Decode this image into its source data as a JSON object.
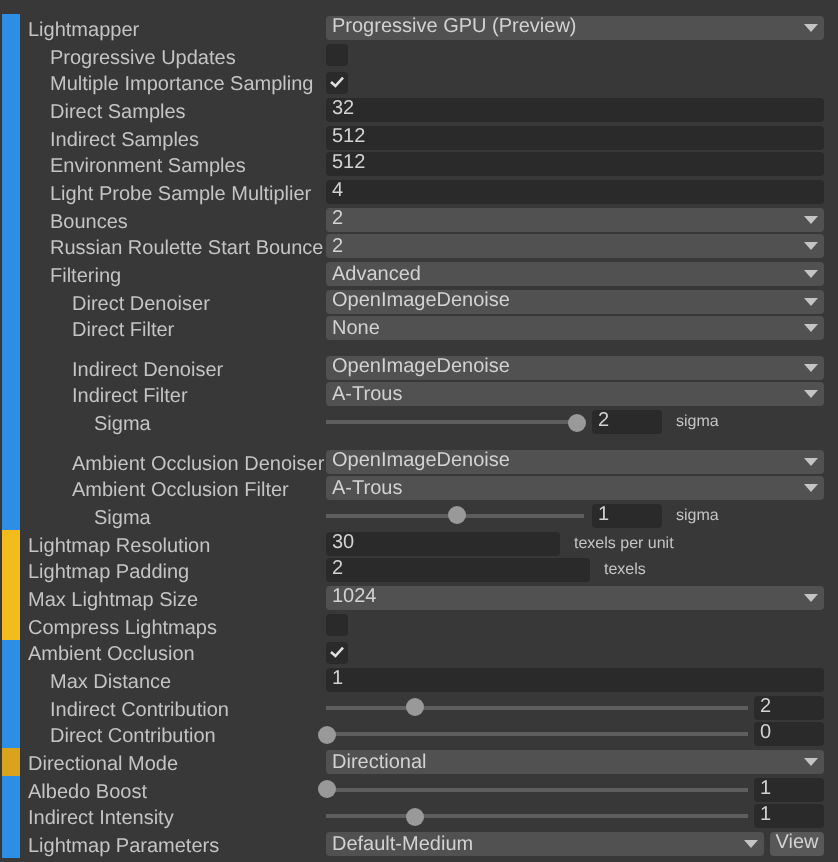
{
  "settings": [
    {
      "label": "Lightmapper",
      "kind": "dropdown",
      "value": "Progressive GPU (Preview)",
      "color": "#2d8ee6",
      "children": [
        {
          "label": "Progressive Updates",
          "kind": "checkbox",
          "checked": false
        },
        {
          "label": "Multiple Importance Sampling",
          "kind": "checkbox",
          "checked": true
        },
        {
          "label": "Direct Samples",
          "kind": "field",
          "value": "32"
        },
        {
          "label": "Indirect Samples",
          "kind": "field",
          "value": "512"
        },
        {
          "label": "Environment Samples",
          "kind": "field",
          "value": "512"
        },
        {
          "label": "Light Probe Sample Multiplier",
          "kind": "field",
          "value": "4"
        },
        {
          "label": "Bounces",
          "kind": "dropdown",
          "value": "2"
        },
        {
          "label": "Russian Roulette Start Bounce",
          "kind": "dropdown",
          "value": "2"
        },
        {
          "label": "Filtering",
          "kind": "dropdown",
          "value": "Advanced",
          "children": [
            {
              "label": "Direct Denoiser",
              "kind": "dropdown",
              "value": "OpenImageDenoise"
            },
            {
              "label": "Direct Filter",
              "kind": "dropdown",
              "value": "None"
            },
            {
              "label": "Indirect Denoiser",
              "kind": "dropdown",
              "value": "OpenImageDenoise",
              "gap_before": true
            },
            {
              "label": "Indirect Filter",
              "kind": "dropdown",
              "value": "A-Trous",
              "children": [
                {
                  "label": "Sigma",
                  "kind": "slider_unit",
                  "value": "2",
                  "unit": "sigma",
                  "level": 0.97
                }
              ]
            },
            {
              "label": "Ambient Occlusion Denoiser",
              "kind": "dropdown",
              "value": "OpenImageDenoise",
              "gap_before": true
            },
            {
              "label": "Ambient Occlusion Filter",
              "kind": "dropdown",
              "value": "A-Trous",
              "children": [
                {
                  "label": "Sigma",
                  "kind": "slider_unit",
                  "value": "1",
                  "unit": "sigma",
                  "level": 0.5
                }
              ]
            }
          ]
        }
      ]
    },
    {
      "label": "Lightmap Resolution",
      "kind": "field_unit",
      "value": "30",
      "unit": "texels per unit",
      "color": "#f4bb1c"
    },
    {
      "label": "Lightmap Padding",
      "kind": "field_unit",
      "value": "2",
      "unit": "texels",
      "color": "#f4bb1c"
    },
    {
      "label": "Max Lightmap Size",
      "kind": "dropdown",
      "value": "1024",
      "color": "#f4bb1c"
    },
    {
      "label": "Compress Lightmaps",
      "kind": "checkbox",
      "checked": false,
      "color": "#f4bb1c"
    },
    {
      "label": "Ambient Occlusion",
      "kind": "checkbox",
      "checked": true,
      "color": "#2d8ee6",
      "children": [
        {
          "label": "Max Distance",
          "kind": "field",
          "value": "1"
        },
        {
          "label": "Indirect Contribution",
          "kind": "slider",
          "value": "2",
          "level": 0.21
        },
        {
          "label": "Direct Contribution",
          "kind": "slider",
          "value": "0",
          "level": 0
        }
      ]
    },
    {
      "label": "Directional Mode",
      "kind": "dropdown",
      "value": "Directional",
      "color": "#d9a31e"
    },
    {
      "label": "Albedo Boost",
      "kind": "slider",
      "value": "1",
      "level": 0,
      "color": "#2d8ee6"
    },
    {
      "label": "Indirect Intensity",
      "kind": "slider",
      "value": "1",
      "level": 0.21,
      "color": "#2d8ee6"
    },
    {
      "label": "Lightmap Parameters",
      "kind": "dropdown_button",
      "value": "Default-Medium",
      "button": "View",
      "color": "#2d8ee6"
    }
  ]
}
